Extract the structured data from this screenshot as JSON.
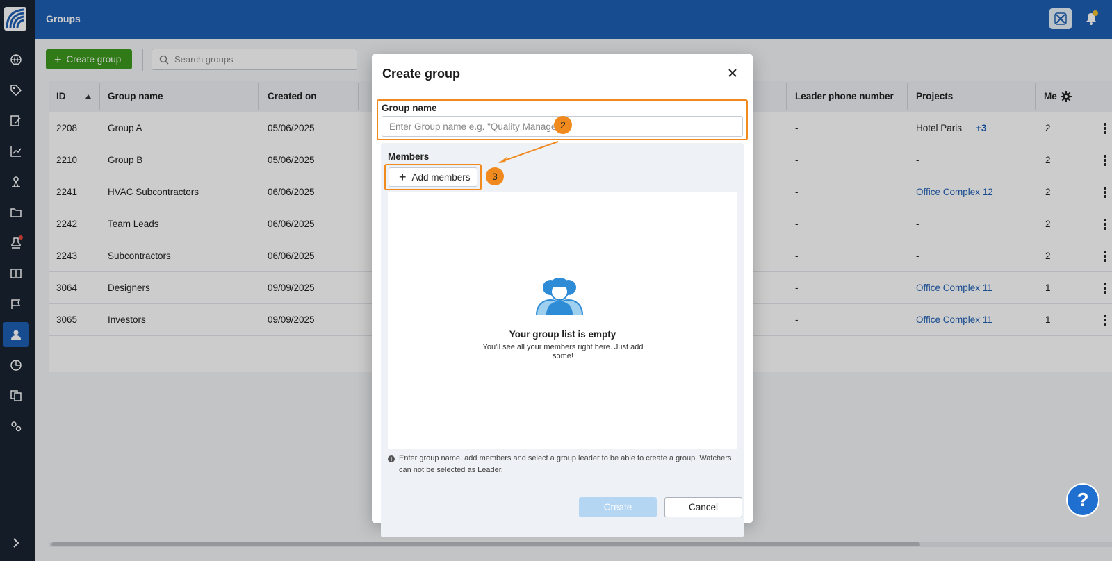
{
  "topbar": {
    "title": "Groups"
  },
  "toolbar": {
    "create_label": "Create group",
    "search_placeholder": "Search groups"
  },
  "table": {
    "columns": {
      "id": "ID",
      "group_name": "Group name",
      "created_on": "Created on",
      "leader_phone": "Leader phone number",
      "projects": "Projects",
      "members": "Me"
    },
    "rows": [
      {
        "id": "2208",
        "name": "Group A",
        "created": "05/06/2025",
        "phone": "-",
        "project": "Hotel Paris",
        "extra": "+3",
        "members": "2"
      },
      {
        "id": "2210",
        "name": "Group B",
        "created": "05/06/2025",
        "phone": "-",
        "project": "-",
        "extra": "",
        "members": "2"
      },
      {
        "id": "2241",
        "name": "HVAC Subcontractors",
        "created": "06/06/2025",
        "phone": "-",
        "project": "Office Complex 12",
        "extra": "",
        "members": "2"
      },
      {
        "id": "2242",
        "name": "Team Leads",
        "created": "06/06/2025",
        "phone": "-",
        "project": "-",
        "extra": "",
        "members": "2"
      },
      {
        "id": "2243",
        "name": "Subcontractors",
        "created": "06/06/2025",
        "phone": "-",
        "project": "-",
        "extra": "",
        "members": "2"
      },
      {
        "id": "3064",
        "name": "Designers",
        "created": "09/09/2025",
        "phone": "-",
        "project": "Office Complex 11",
        "extra": "",
        "members": "1"
      },
      {
        "id": "3065",
        "name": "Investors",
        "created": "09/09/2025",
        "phone": "-",
        "project": "Office Complex 11",
        "extra": "",
        "members": "1"
      }
    ]
  },
  "modal": {
    "title": "Create group",
    "name_label": "Group name",
    "name_placeholder": "Enter Group name e.g. \"Quality Manager\"",
    "members_label": "Members",
    "add_members_label": "Add members",
    "empty_title": "Your group list is empty",
    "empty_sub": "You'll see all your members right here. Just add some!",
    "info_note": "Enter group name, add members and select a group leader to be able to create a group. Watchers can not be selected as Leader.",
    "create_label": "Create",
    "cancel_label": "Cancel"
  },
  "annotations": {
    "step_name": "2",
    "step_add": "3"
  },
  "help": {
    "label": "?"
  },
  "colors": {
    "primary": "#1f5fb5",
    "success": "#3c9a1e",
    "highlight": "#f08a1e",
    "sidebar": "#1a2333"
  }
}
